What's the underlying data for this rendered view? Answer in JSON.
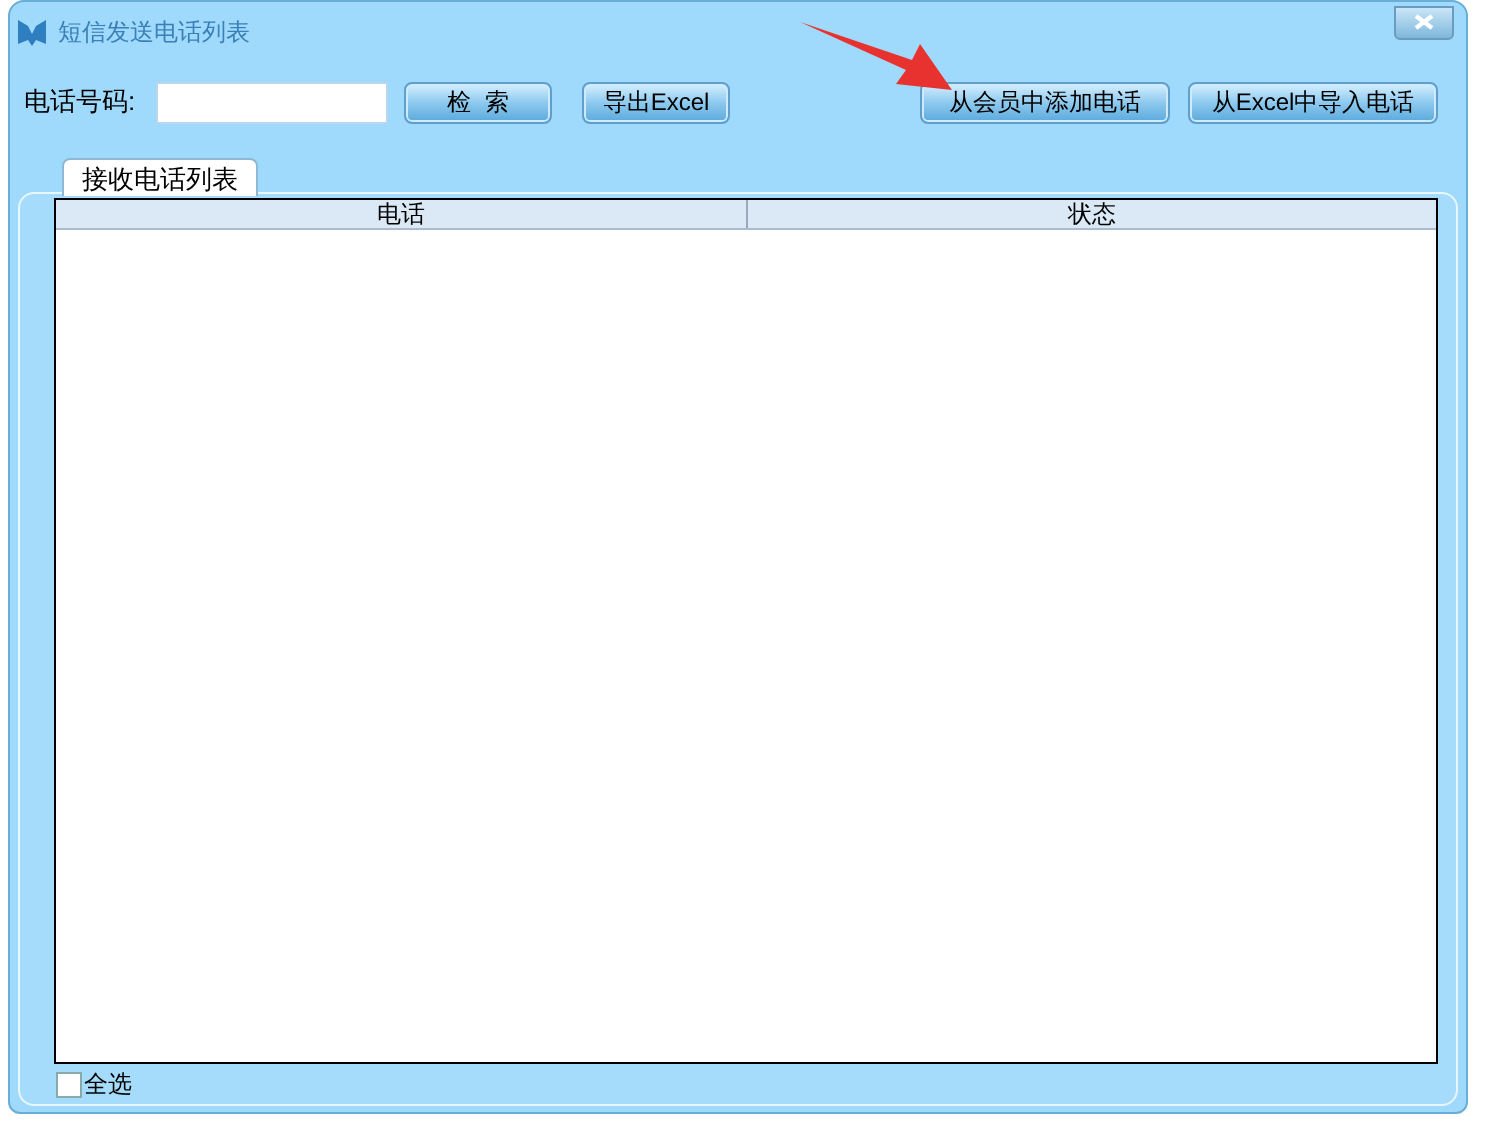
{
  "window": {
    "title": "短信发送电话列表"
  },
  "search": {
    "label": "电话号码:"
  },
  "buttons": [
    {
      "label": "检  索",
      "kind": "left"
    },
    {
      "label": "导出Excel",
      "kind": "left"
    },
    {
      "label": "从会员中添加电话",
      "kind": "right"
    },
    {
      "label": "从Excel中导入电话",
      "kind": "right"
    }
  ],
  "tabs": [
    {
      "label": "接收电话列表",
      "selected": true
    }
  ],
  "table": {
    "columns": [
      "电话",
      "状态"
    ]
  },
  "select_all": {
    "label": "全选",
    "checked": false
  }
}
